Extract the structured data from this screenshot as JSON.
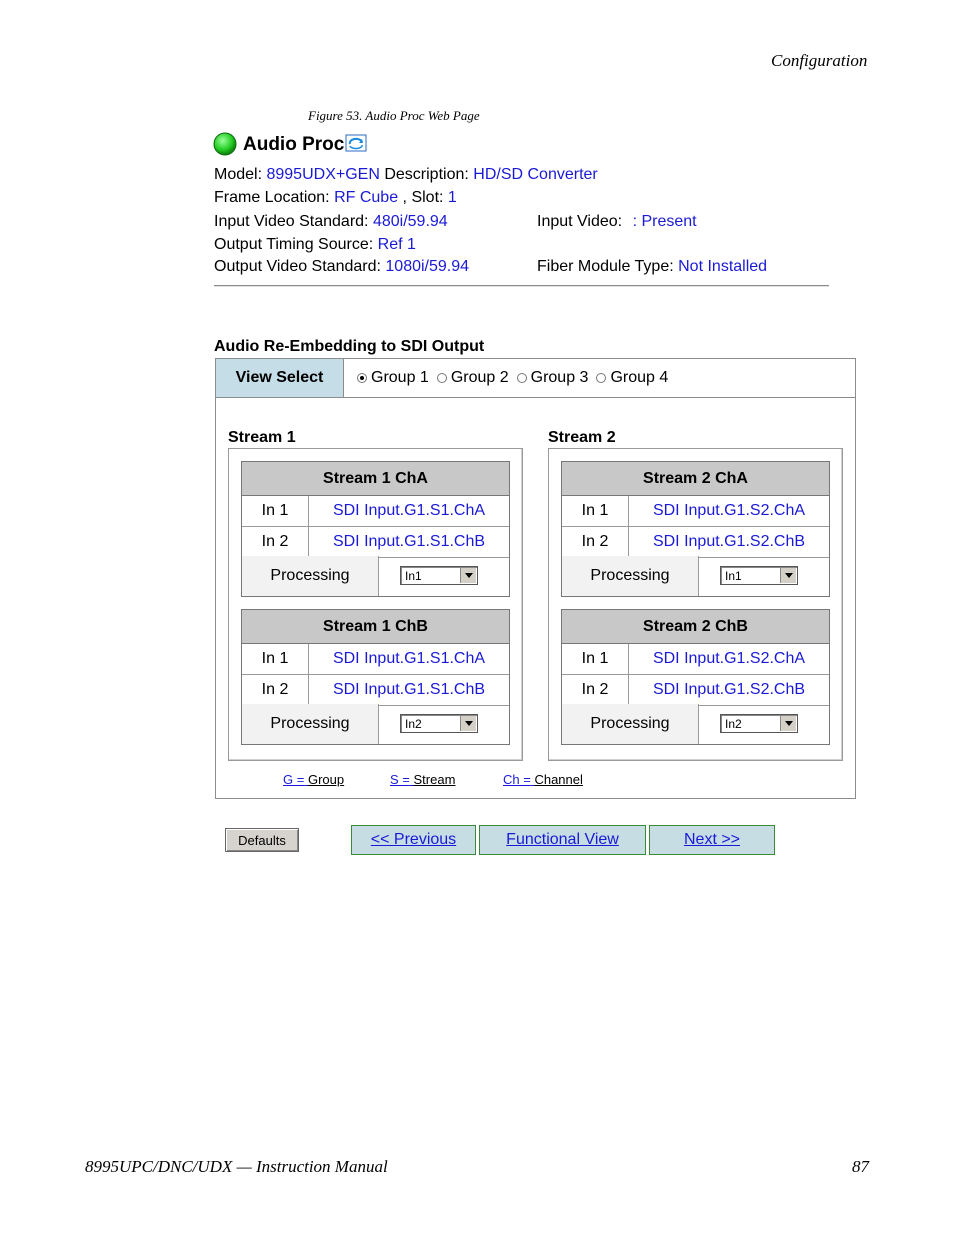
{
  "page": {
    "section_header": "Configuration",
    "figure_caption": "Figure 53.  Audio Proc Web Page",
    "footer_left": "8995UPC/DNC/UDX — Instruction Manual",
    "footer_right": "87"
  },
  "app": {
    "title": "Audio Proc",
    "status_color": "#22cc22",
    "refresh_icon": "refresh-icon"
  },
  "info": {
    "model_label": "Model:",
    "model_value": "8995UDX+GEN",
    "description_label": "Description:",
    "description_value": "HD/SD Converter",
    "frame_label": "Frame Location:",
    "frame_value": "RF Cube",
    "slot_label": ", Slot:",
    "slot_value": "1",
    "input_std_label": "Input Video Standard:",
    "input_std_value": "480i/59.94",
    "input_video_label": "Input Video:",
    "input_video_value": ": Present",
    "timing_label": "Output Timing Source:",
    "timing_value": "Ref 1",
    "output_std_label": "Output Video Standard:",
    "output_std_value": "1080i/59.94",
    "fiber_label": "Fiber Module Type:",
    "fiber_value": "Not Installed"
  },
  "reembed": {
    "title": "Audio Re-Embedding to SDI Output",
    "view_select_label": "View Select",
    "groups": [
      {
        "label": "Group 1",
        "selected": true
      },
      {
        "label": "Group 2",
        "selected": false
      },
      {
        "label": "Group 3",
        "selected": false
      },
      {
        "label": "Group 4",
        "selected": false
      }
    ],
    "streams": [
      {
        "title": "Stream 1",
        "channels": [
          {
            "title": "Stream 1 ChA",
            "in1_label": "In 1",
            "in1_value": "SDI Input.G1.S1.ChA",
            "in2_label": "In 2",
            "in2_value": "SDI Input.G1.S1.ChB",
            "processing_label": "Processing",
            "processing_value": "In1"
          },
          {
            "title": "Stream 1 ChB",
            "in1_label": "In 1",
            "in1_value": "SDI Input.G1.S1.ChA",
            "in2_label": "In 2",
            "in2_value": "SDI Input.G1.S1.ChB",
            "processing_label": "Processing",
            "processing_value": "In2"
          }
        ]
      },
      {
        "title": "Stream 2",
        "channels": [
          {
            "title": "Stream 2 ChA",
            "in1_label": "In 1",
            "in1_value": "SDI Input.G1.S2.ChA",
            "in2_label": "In 2",
            "in2_value": "SDI Input.G1.S2.ChB",
            "processing_label": "Processing",
            "processing_value": "In1"
          },
          {
            "title": "Stream 2 ChB",
            "in1_label": "In 1",
            "in1_value": "SDI Input.G1.S2.ChA",
            "in2_label": "In 2",
            "in2_value": "SDI Input.G1.S2.ChB",
            "processing_label": "Processing",
            "processing_value": "In2"
          }
        ]
      }
    ],
    "legend": [
      {
        "key": "G =",
        "value": "Group"
      },
      {
        "key": "S =",
        "value": "Stream"
      },
      {
        "key": "Ch =",
        "value": "Channel"
      }
    ]
  },
  "buttons": {
    "defaults": "Defaults",
    "previous": "<< Previous",
    "functional": "Functional View",
    "next": "Next >>"
  }
}
